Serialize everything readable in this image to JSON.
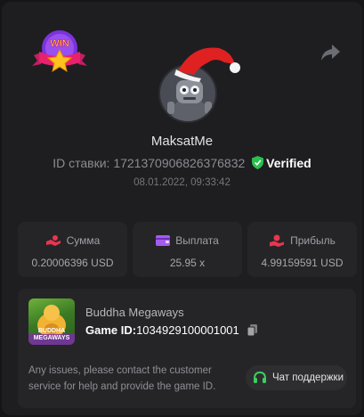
{
  "badge": {
    "text": "WIN"
  },
  "user": {
    "name": "MaksatMe"
  },
  "bet": {
    "label": "ID ставки:",
    "id": "1721370906826376832",
    "verified": "Verified",
    "date": "08.01.2022, 09:33:42"
  },
  "stats": [
    {
      "label": "Сумма",
      "value": "0.20006396 USD",
      "icon": "coins-hand-icon"
    },
    {
      "label": "Выплата",
      "value": "25.95 x",
      "icon": "wallet-icon"
    },
    {
      "label": "Прибыль",
      "value": "4.99159591 USD",
      "icon": "profit-hand-icon"
    }
  ],
  "game": {
    "title": "Buddha Megaways",
    "thumb_text": "BUDDHA MEGAWAYS",
    "id_label": "Game ID:",
    "id_value": "1034929100001001"
  },
  "support": {
    "text": "Any issues, please contact the customer service for help and provide the game ID.",
    "button": "Чат поддержки"
  },
  "colors": {
    "verified_green": "#2bbf4e",
    "stat_icon_red": "#e8364f",
    "stat_icon_purple": "#a45cf0",
    "support_green": "#3ccf5c"
  }
}
